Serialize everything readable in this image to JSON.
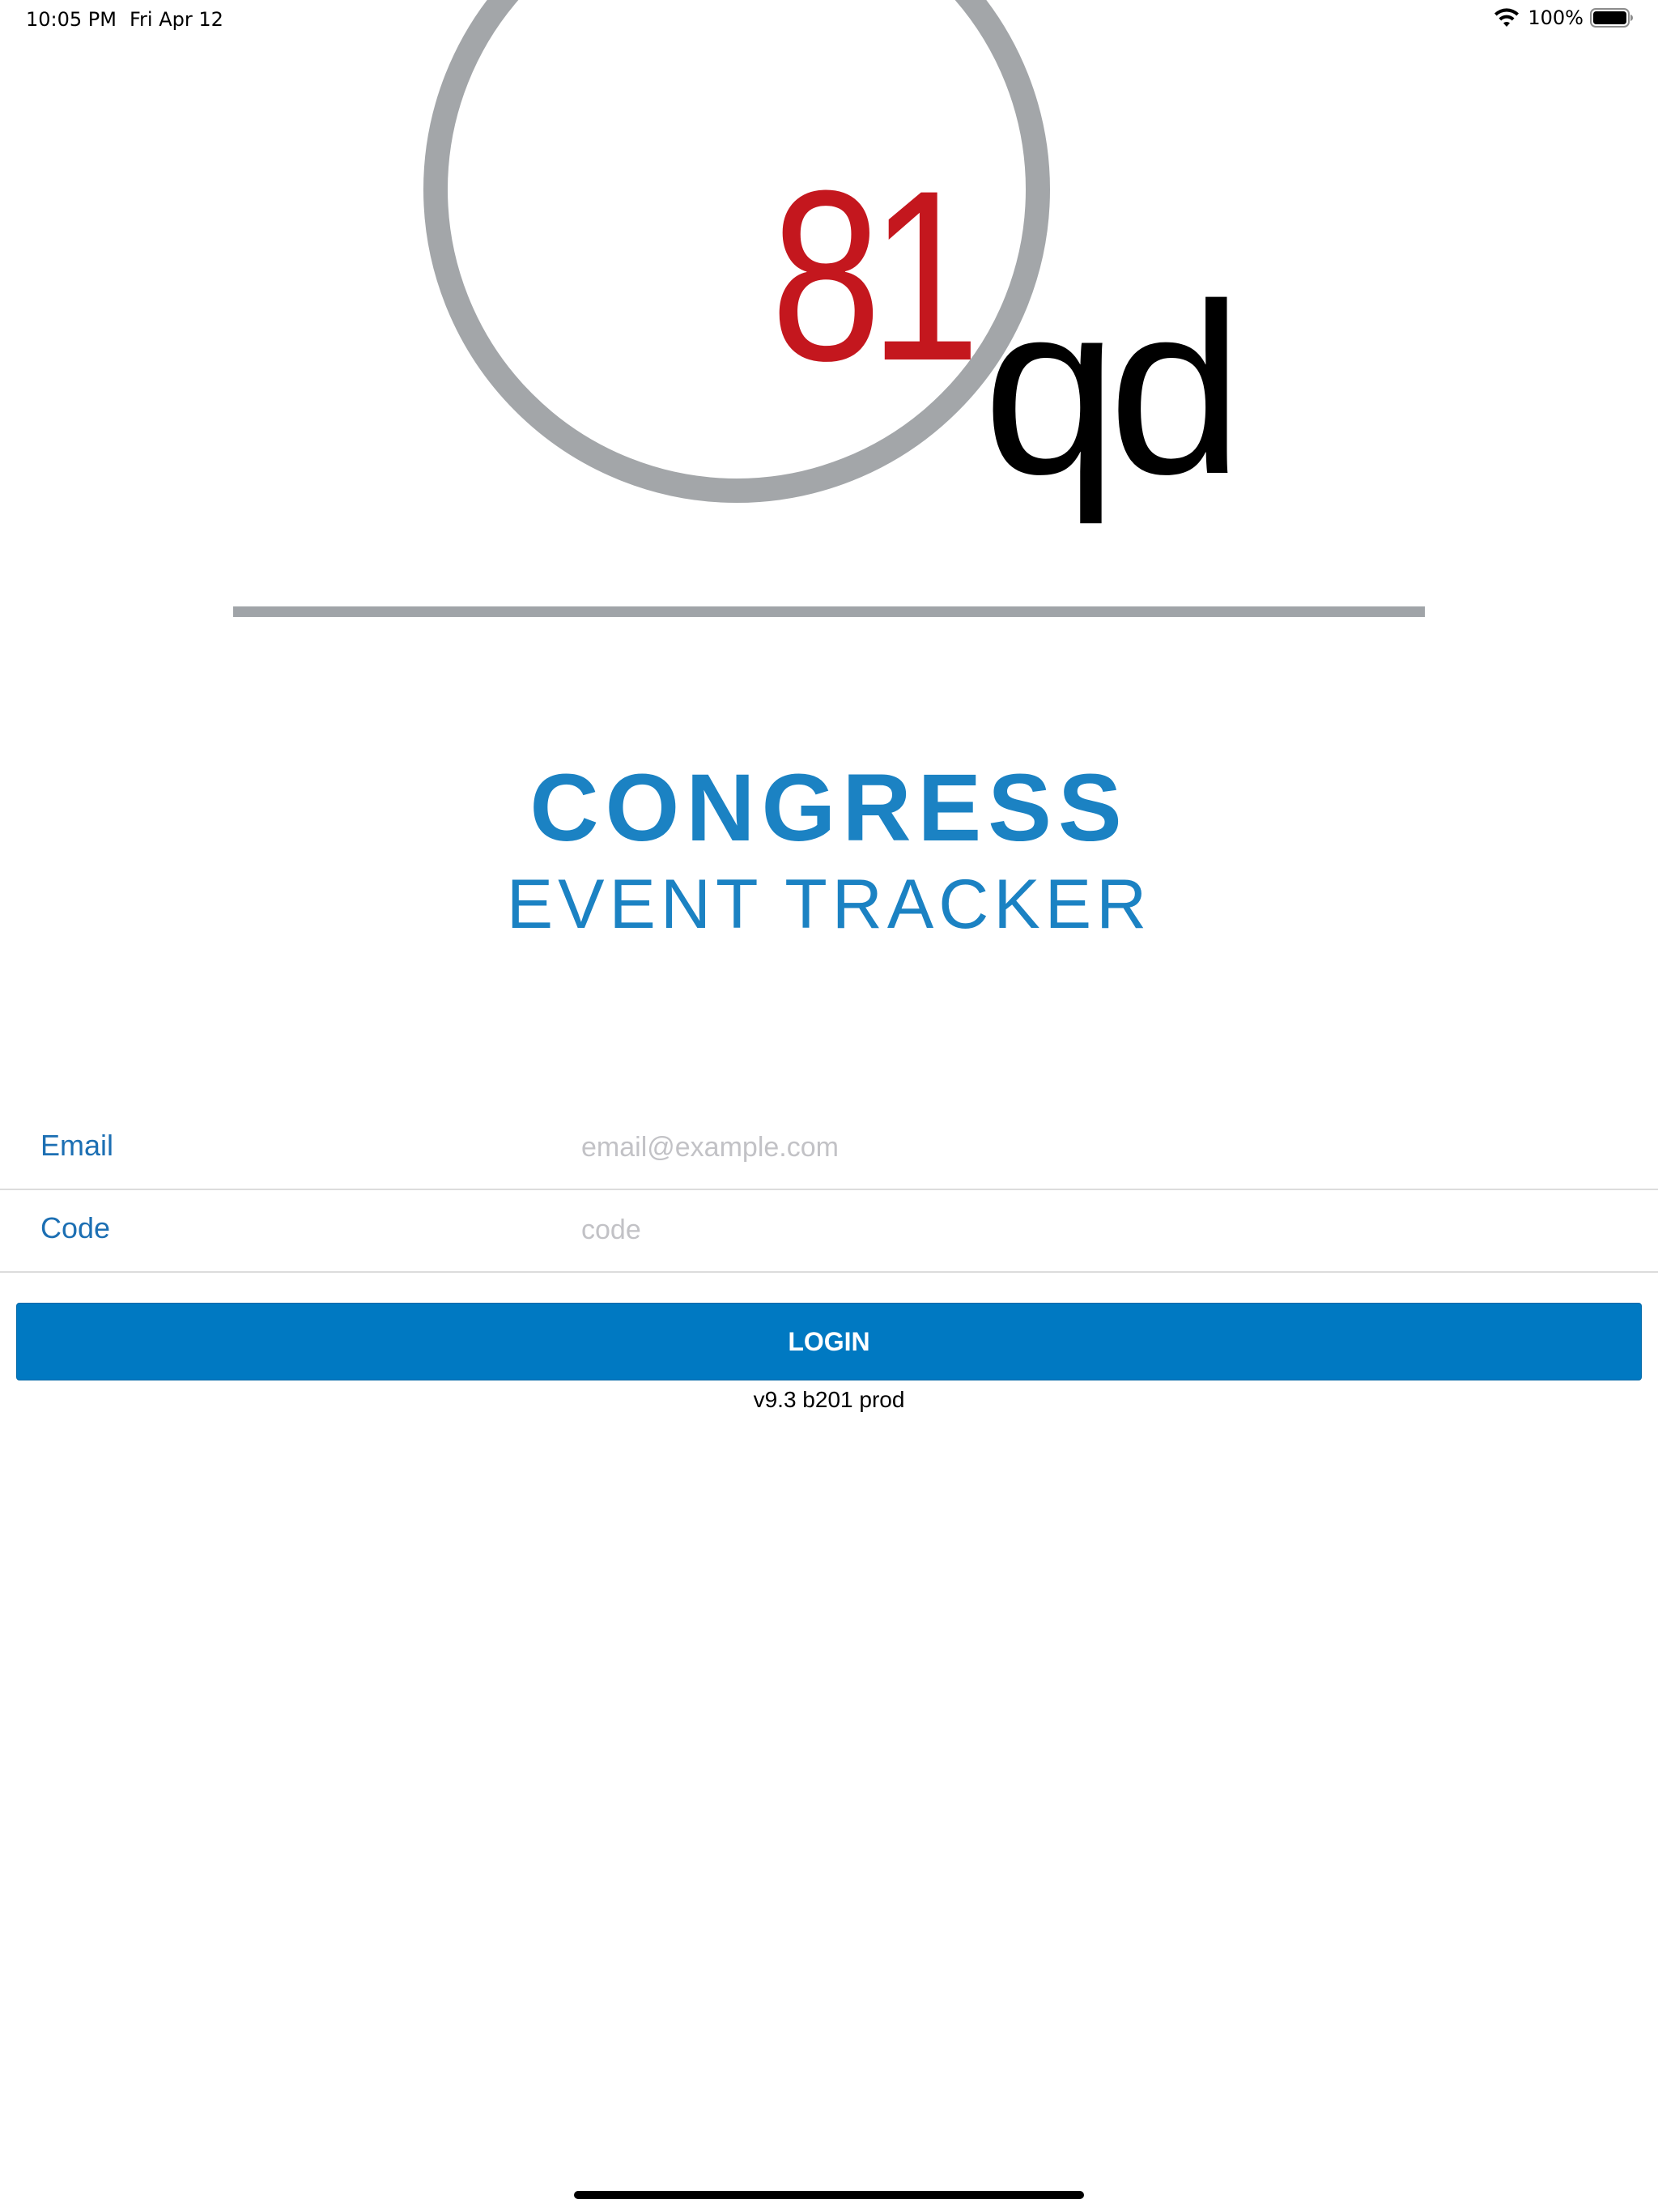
{
  "status_bar": {
    "time": "10:05 PM",
    "date": "Fri Apr 12",
    "battery_percent": "100%",
    "icons": [
      "wifi-icon",
      "battery-icon"
    ]
  },
  "logo": {
    "number": "81",
    "letters": "qd",
    "colors": {
      "circle": "#a3a6a9",
      "number": "#c4171e",
      "letters": "#000000"
    }
  },
  "title": {
    "main": "CONGRESS",
    "sub": "EVENT TRACKER",
    "color": "#1b82c3"
  },
  "form": {
    "email": {
      "label": "Email",
      "placeholder": "email@example.com",
      "value": ""
    },
    "code": {
      "label": "Code",
      "placeholder": "code",
      "value": ""
    }
  },
  "login_button": {
    "label": "LOGIN",
    "color": "#0079c2"
  },
  "version": "v9.3 b201 prod"
}
